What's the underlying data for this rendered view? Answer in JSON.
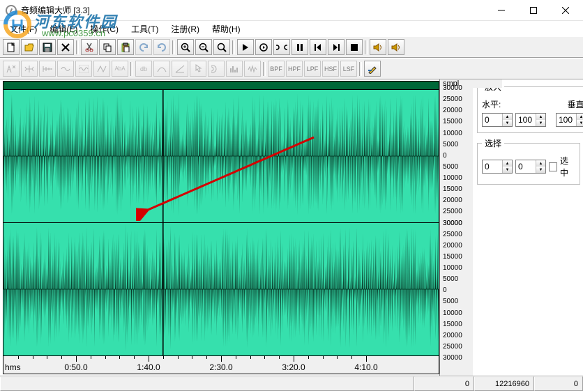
{
  "app": {
    "title": "音频编辑大师  [3.3]"
  },
  "watermark": {
    "brand": "河东软件园",
    "url": "www.pc0359.cn"
  },
  "menu": {
    "file": "文件(F)",
    "edit": "编辑(E)",
    "action": "操作(C)",
    "tools": "工具(T)",
    "reg": "注册(R)",
    "help": "帮助(H)"
  },
  "filterbar": {
    "bpf": "BPF",
    "hpf": "HPF",
    "lpf": "LPF",
    "hsf": "HSF",
    "lsf": "LSF"
  },
  "side": {
    "zoom_title": "放大",
    "horizontal_label": "水平:",
    "vertical_label": "垂直:",
    "h_value": "0",
    "h_max": "100",
    "v_value": "100",
    "select_title": "选择",
    "sel_a": "0",
    "sel_b": "0",
    "sel_chk": "选中"
  },
  "ruler": {
    "unit": "hms",
    "ticks": [
      "0:50.0",
      "1:40.0",
      "2:30.0",
      "3:20.0",
      "4:10.0"
    ]
  },
  "amplitude": {
    "smpl": "smpl",
    "labels": [
      "30000",
      "25000",
      "20000",
      "15000",
      "10000",
      "5000",
      "0",
      "5000",
      "10000",
      "15000",
      "20000",
      "25000",
      "30000"
    ]
  },
  "status": {
    "pos": "0",
    "total": "12216960",
    "extra": "0"
  }
}
